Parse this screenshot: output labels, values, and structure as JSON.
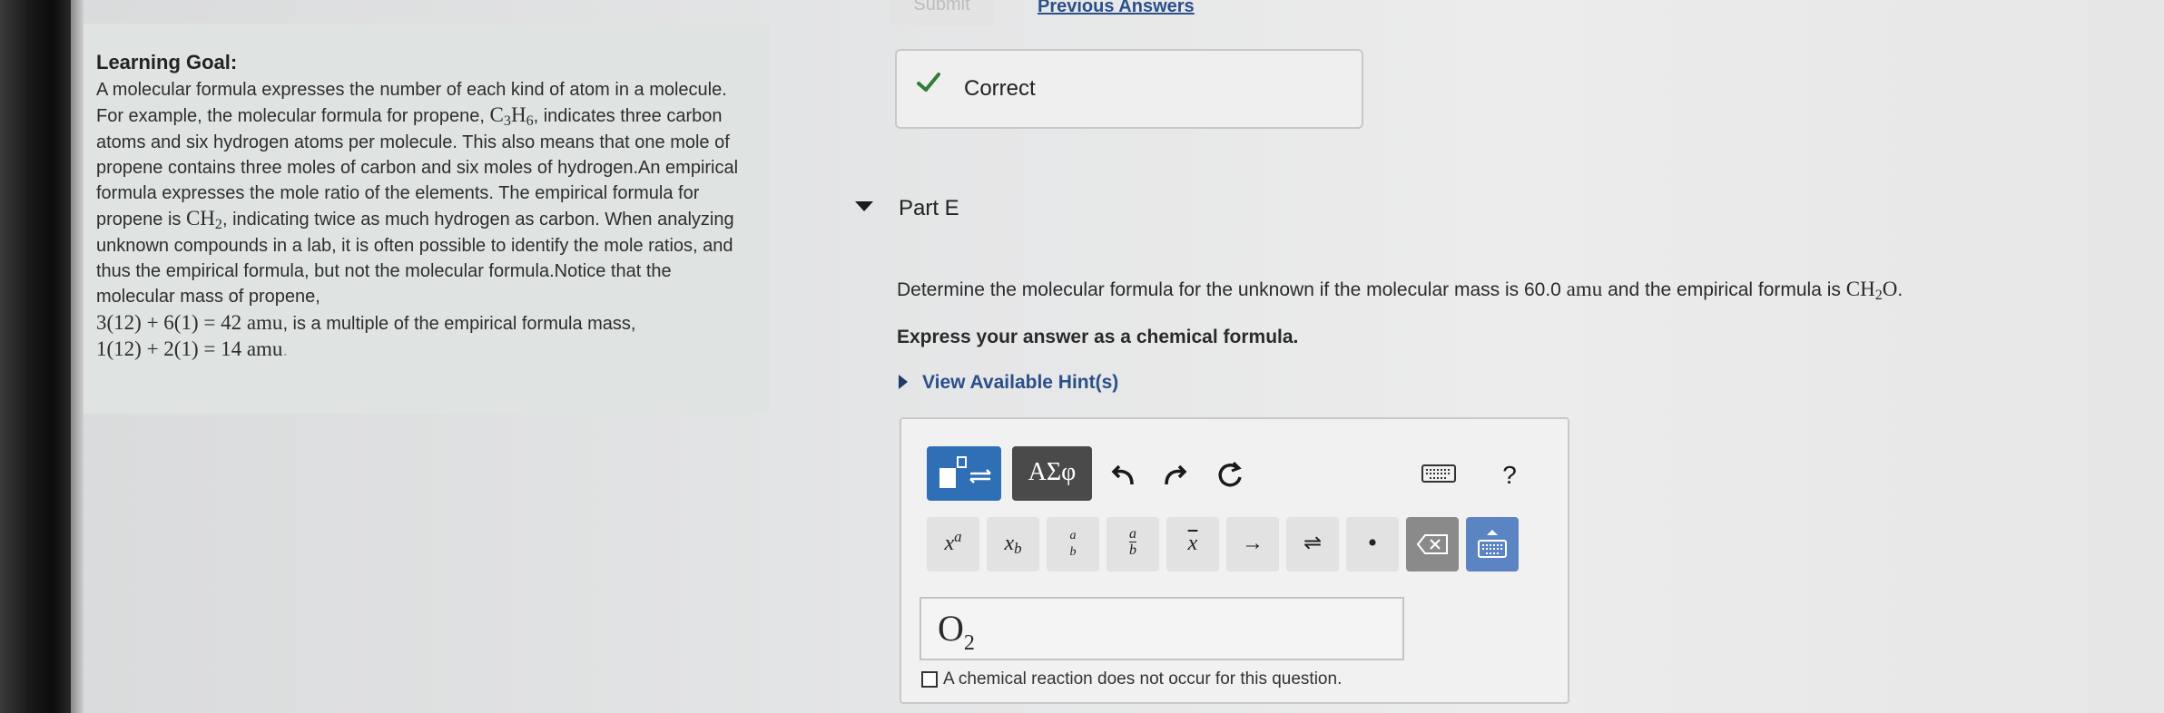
{
  "top": {
    "submit_label": "Submit",
    "previous_answers_label": "Previous Answers"
  },
  "learning_goal": {
    "title": "Learning Goal:",
    "p1": "A molecular formula expresses the number of each kind of atom in a molecule. For example, the molecular formula for propene, ",
    "propene_formula": "C3H6",
    "p2": ", indicates three carbon atoms and six hydrogen atoms per molecule. This also means that one mole of propene contains three moles of carbon and six moles of hydrogen.An empirical formula expresses the mole ratio of the elements. The empirical formula for propene is ",
    "empirical_formula": "CH2",
    "p3": ", indicating twice as much hydrogen as carbon. When analyzing unknown compounds in a lab, it is often possible to identify the mole ratios, and thus the empirical formula, but not the molecular formula.Notice that the molecular mass of propene,",
    "eq1": "3(12) + 6(1) = 42 amu",
    "p4": ", is a multiple of the empirical formula mass,",
    "eq2": "1(12) + 2(1) = 14 amu",
    "p5": "."
  },
  "feedback": {
    "status": "Correct"
  },
  "part": {
    "title": "Part E",
    "question_pre": "Determine the molecular formula for the unknown if the molecular mass is 60.0 ",
    "unit": "amu",
    "question_mid": " and the empirical formula is ",
    "empirical": "CH2O",
    "question_post": ".",
    "instruction": "Express your answer as a chemical formula.",
    "hint_label": "View Available Hint(s)"
  },
  "toolbar": {
    "greek_label": "ΑΣφ",
    "help_label": "?",
    "keys": [
      "x^a",
      "x_b",
      "a/b (small)",
      "a/b",
      "x-bar",
      "→",
      "⇌",
      "•",
      "backspace",
      "keyboard"
    ]
  },
  "answer": {
    "element": "O",
    "subscript": "2",
    "no_reaction_label": "A chemical reaction does not occur for this question."
  },
  "colors": {
    "accent_blue": "#2f6fb5",
    "link": "#2a4f8a",
    "check_green": "#2e7d32"
  }
}
